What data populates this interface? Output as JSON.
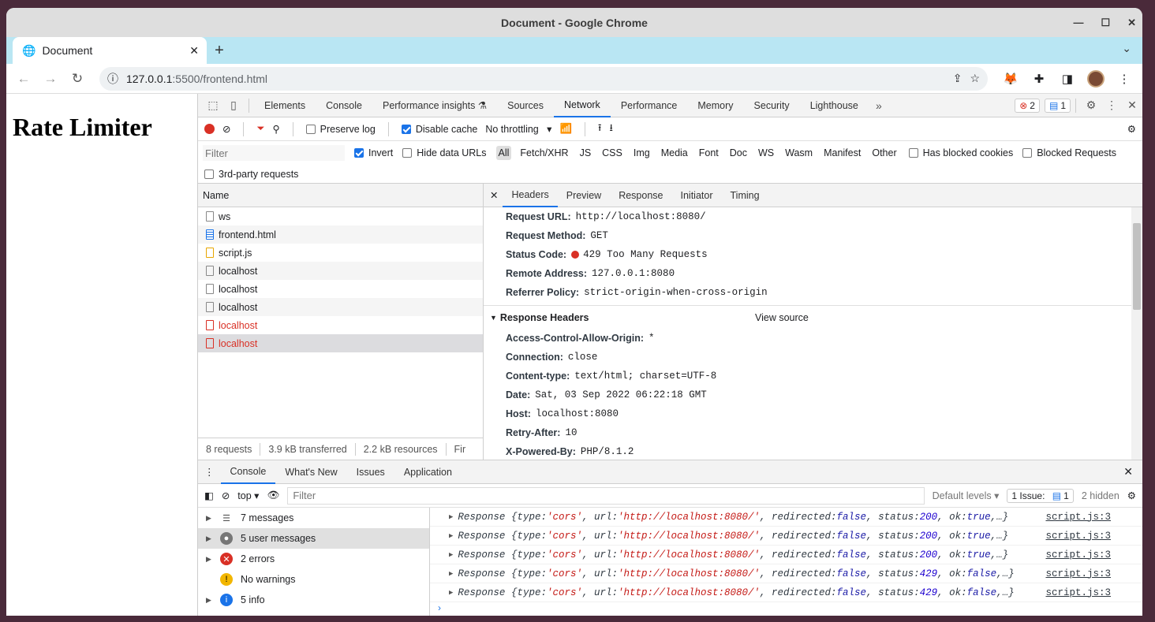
{
  "window": {
    "title": "Document - Google Chrome"
  },
  "tab": {
    "title": "Document"
  },
  "address": {
    "host": "127.0.0.1",
    "path": ":5500/frontend.html"
  },
  "page": {
    "heading": "Rate Limiter"
  },
  "devtools": {
    "tabs": [
      "Elements",
      "Console",
      "Performance insights",
      "Sources",
      "Network",
      "Performance",
      "Memory",
      "Security",
      "Lighthouse"
    ],
    "active_tab": "Network",
    "error_count": "2",
    "issue_count": "1",
    "network_toolbar": {
      "preserve_log": "Preserve log",
      "disable_cache": "Disable cache",
      "throttling": "No throttling"
    },
    "filter": {
      "placeholder": "Filter",
      "invert": "Invert",
      "hide_data_urls": "Hide data URLs",
      "types": [
        "All",
        "Fetch/XHR",
        "JS",
        "CSS",
        "Img",
        "Media",
        "Font",
        "Doc",
        "WS",
        "Wasm",
        "Manifest",
        "Other"
      ],
      "has_blocked_cookies": "Has blocked cookies",
      "blocked_requests": "Blocked Requests",
      "third_party": "3rd-party requests"
    },
    "requests": {
      "header": "Name",
      "rows": [
        {
          "name": "ws",
          "kind": "plain",
          "error": false
        },
        {
          "name": "frontend.html",
          "kind": "doc",
          "error": false
        },
        {
          "name": "script.js",
          "kind": "js",
          "error": false
        },
        {
          "name": "localhost",
          "kind": "plain",
          "error": false
        },
        {
          "name": "localhost",
          "kind": "plain",
          "error": false
        },
        {
          "name": "localhost",
          "kind": "plain",
          "error": false
        },
        {
          "name": "localhost",
          "kind": "err",
          "error": true
        },
        {
          "name": "localhost",
          "kind": "err",
          "error": true
        }
      ],
      "footer": {
        "count": "8 requests",
        "transferred": "3.9 kB transferred",
        "resources": "2.2 kB resources",
        "finish": "Fir"
      }
    },
    "details": {
      "tabs": [
        "Headers",
        "Preview",
        "Response",
        "Initiator",
        "Timing"
      ],
      "general": [
        {
          "k": "Request URL:",
          "v": "http://localhost:8080/"
        },
        {
          "k": "Request Method:",
          "v": "GET"
        },
        {
          "k": "Status Code:",
          "v": "429 Too Many Requests"
        },
        {
          "k": "Remote Address:",
          "v": "127.0.0.1:8080"
        },
        {
          "k": "Referrer Policy:",
          "v": "strict-origin-when-cross-origin"
        }
      ],
      "response_headers_title": "Response Headers",
      "view_source": "View source",
      "response_headers": [
        {
          "k": "Access-Control-Allow-Origin:",
          "v": "*"
        },
        {
          "k": "Connection:",
          "v": "close"
        },
        {
          "k": "Content-type:",
          "v": "text/html; charset=UTF-8"
        },
        {
          "k": "Date:",
          "v": "Sat, 03 Sep 2022 06:22:18 GMT"
        },
        {
          "k": "Host:",
          "v": "localhost:8080"
        },
        {
          "k": "Retry-After:",
          "v": "10"
        },
        {
          "k": "X-Powered-By:",
          "v": "PHP/8.1.2"
        }
      ]
    },
    "drawer": {
      "tabs": [
        "Console",
        "What's New",
        "Issues",
        "Application"
      ],
      "context": "top",
      "filter_placeholder": "Filter",
      "levels": "Default levels",
      "issues": "1 Issue:",
      "issues_count": "1",
      "hidden": "2 hidden",
      "sidebar": [
        {
          "label": "7 messages",
          "icon": "list"
        },
        {
          "label": "5 user messages",
          "icon": "user"
        },
        {
          "label": "2 errors",
          "icon": "error"
        },
        {
          "label": "No warnings",
          "icon": "warning"
        },
        {
          "label": "5 info",
          "icon": "info"
        }
      ],
      "logs": [
        {
          "status": "200",
          "ok": "true",
          "tail": "…}",
          "src": "script.js:3"
        },
        {
          "status": "200",
          "ok": "true",
          "tail": "…}",
          "src": "script.js:3"
        },
        {
          "status": "200",
          "ok": "true",
          "tail": "…}",
          "src": "script.js:3"
        },
        {
          "status": "429",
          "ok": "false",
          "tail": "…}",
          "src": "script.js:3"
        },
        {
          "status": "429",
          "ok": "false",
          "tail": "…}",
          "src": "script.js:3"
        }
      ],
      "log_prefix": "Response",
      "log_type": "'cors'",
      "log_url": "'http://localhost:8080/'",
      "log_redirected": "false"
    }
  }
}
